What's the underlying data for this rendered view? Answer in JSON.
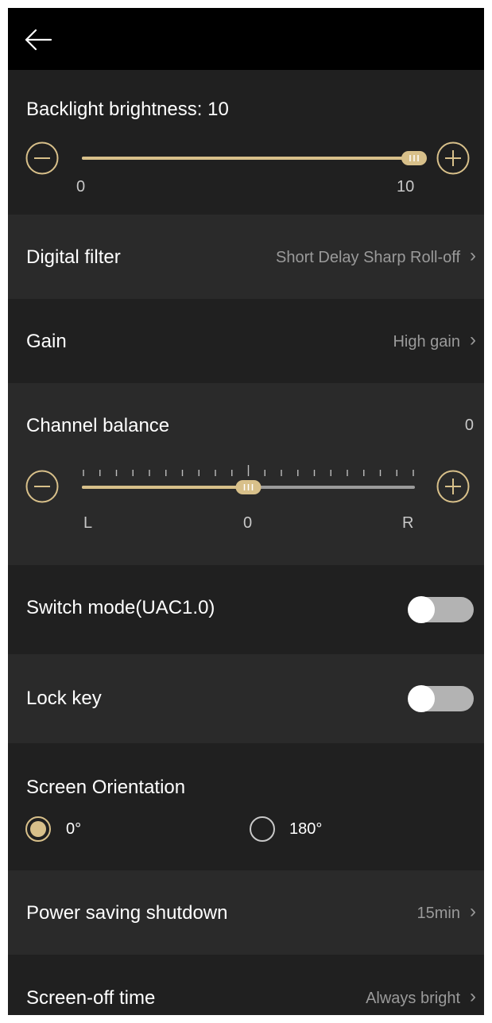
{
  "brightness": {
    "title": "Backlight brightness: 10",
    "value": 10,
    "min": 0,
    "max": 10,
    "min_label": "0",
    "max_label": "10"
  },
  "digital_filter": {
    "title": "Digital filter",
    "value": "Short Delay Sharp Roll-off"
  },
  "gain": {
    "title": "Gain",
    "value": "High gain"
  },
  "balance": {
    "title": "Channel balance",
    "value_label": "0",
    "value": 0,
    "min": -10,
    "max": 10,
    "left_label": "L",
    "center_label": "0",
    "right_label": "R"
  },
  "uac": {
    "title": "Switch mode(UAC1.0)",
    "on": false
  },
  "lock_key": {
    "title": "Lock key",
    "on": false
  },
  "orientation": {
    "title": "Screen Orientation",
    "options": [
      {
        "label": "0°",
        "selected": true
      },
      {
        "label": "180°",
        "selected": false
      }
    ]
  },
  "power_saving": {
    "title": "Power saving shutdown",
    "value": "15min"
  },
  "screen_off": {
    "title": "Screen-off time",
    "value": "Always bright"
  },
  "icons": {
    "back": "arrow-left-icon",
    "minus": "minus-circle-icon",
    "plus": "plus-circle-icon",
    "chevron": "chevron-right-icon"
  },
  "colors": {
    "accent": "#d8c08a",
    "track_off": "#9b9b9b",
    "toggle_off": "#b3b3b3",
    "knob": "#ffffff"
  }
}
